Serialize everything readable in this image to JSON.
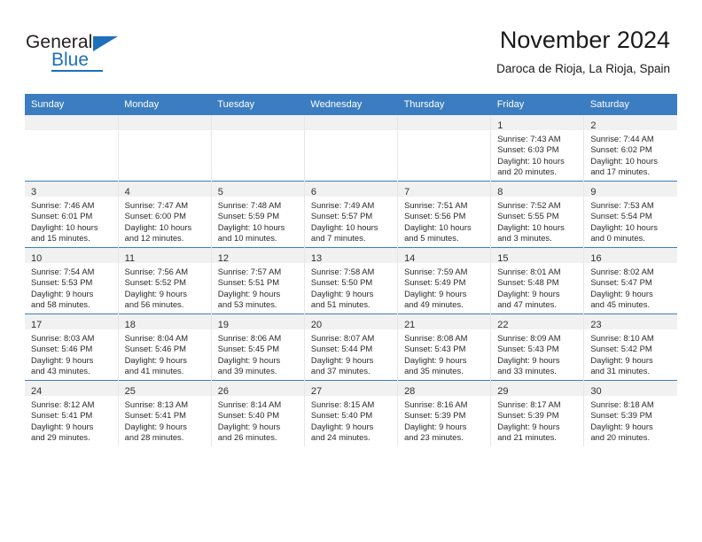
{
  "brand": {
    "name_top": "General",
    "name_bottom": "Blue",
    "accent_color": "#1f6fba"
  },
  "header": {
    "title": "November 2024",
    "subtitle": "Daroca de Rioja, La Rioja, Spain"
  },
  "theme": {
    "header_row_color": "#3b7dc0",
    "day_band_color": "#f1f1f1",
    "text_color": "#2a2a2a"
  },
  "weekdays": [
    "Sunday",
    "Monday",
    "Tuesday",
    "Wednesday",
    "Thursday",
    "Friday",
    "Saturday"
  ],
  "weeks": [
    [
      {
        "day": "",
        "empty": true
      },
      {
        "day": "",
        "empty": true
      },
      {
        "day": "",
        "empty": true
      },
      {
        "day": "",
        "empty": true
      },
      {
        "day": "",
        "empty": true
      },
      {
        "day": "1",
        "sunrise": "Sunrise: 7:43 AM",
        "sunset": "Sunset: 6:03 PM",
        "daylight1": "Daylight: 10 hours",
        "daylight2": "and 20 minutes."
      },
      {
        "day": "2",
        "sunrise": "Sunrise: 7:44 AM",
        "sunset": "Sunset: 6:02 PM",
        "daylight1": "Daylight: 10 hours",
        "daylight2": "and 17 minutes."
      }
    ],
    [
      {
        "day": "3",
        "sunrise": "Sunrise: 7:46 AM",
        "sunset": "Sunset: 6:01 PM",
        "daylight1": "Daylight: 10 hours",
        "daylight2": "and 15 minutes."
      },
      {
        "day": "4",
        "sunrise": "Sunrise: 7:47 AM",
        "sunset": "Sunset: 6:00 PM",
        "daylight1": "Daylight: 10 hours",
        "daylight2": "and 12 minutes."
      },
      {
        "day": "5",
        "sunrise": "Sunrise: 7:48 AM",
        "sunset": "Sunset: 5:59 PM",
        "daylight1": "Daylight: 10 hours",
        "daylight2": "and 10 minutes."
      },
      {
        "day": "6",
        "sunrise": "Sunrise: 7:49 AM",
        "sunset": "Sunset: 5:57 PM",
        "daylight1": "Daylight: 10 hours",
        "daylight2": "and 7 minutes."
      },
      {
        "day": "7",
        "sunrise": "Sunrise: 7:51 AM",
        "sunset": "Sunset: 5:56 PM",
        "daylight1": "Daylight: 10 hours",
        "daylight2": "and 5 minutes."
      },
      {
        "day": "8",
        "sunrise": "Sunrise: 7:52 AM",
        "sunset": "Sunset: 5:55 PM",
        "daylight1": "Daylight: 10 hours",
        "daylight2": "and 3 minutes."
      },
      {
        "day": "9",
        "sunrise": "Sunrise: 7:53 AM",
        "sunset": "Sunset: 5:54 PM",
        "daylight1": "Daylight: 10 hours",
        "daylight2": "and 0 minutes."
      }
    ],
    [
      {
        "day": "10",
        "sunrise": "Sunrise: 7:54 AM",
        "sunset": "Sunset: 5:53 PM",
        "daylight1": "Daylight: 9 hours",
        "daylight2": "and 58 minutes."
      },
      {
        "day": "11",
        "sunrise": "Sunrise: 7:56 AM",
        "sunset": "Sunset: 5:52 PM",
        "daylight1": "Daylight: 9 hours",
        "daylight2": "and 56 minutes."
      },
      {
        "day": "12",
        "sunrise": "Sunrise: 7:57 AM",
        "sunset": "Sunset: 5:51 PM",
        "daylight1": "Daylight: 9 hours",
        "daylight2": "and 53 minutes."
      },
      {
        "day": "13",
        "sunrise": "Sunrise: 7:58 AM",
        "sunset": "Sunset: 5:50 PM",
        "daylight1": "Daylight: 9 hours",
        "daylight2": "and 51 minutes."
      },
      {
        "day": "14",
        "sunrise": "Sunrise: 7:59 AM",
        "sunset": "Sunset: 5:49 PM",
        "daylight1": "Daylight: 9 hours",
        "daylight2": "and 49 minutes."
      },
      {
        "day": "15",
        "sunrise": "Sunrise: 8:01 AM",
        "sunset": "Sunset: 5:48 PM",
        "daylight1": "Daylight: 9 hours",
        "daylight2": "and 47 minutes."
      },
      {
        "day": "16",
        "sunrise": "Sunrise: 8:02 AM",
        "sunset": "Sunset: 5:47 PM",
        "daylight1": "Daylight: 9 hours",
        "daylight2": "and 45 minutes."
      }
    ],
    [
      {
        "day": "17",
        "sunrise": "Sunrise: 8:03 AM",
        "sunset": "Sunset: 5:46 PM",
        "daylight1": "Daylight: 9 hours",
        "daylight2": "and 43 minutes."
      },
      {
        "day": "18",
        "sunrise": "Sunrise: 8:04 AM",
        "sunset": "Sunset: 5:46 PM",
        "daylight1": "Daylight: 9 hours",
        "daylight2": "and 41 minutes."
      },
      {
        "day": "19",
        "sunrise": "Sunrise: 8:06 AM",
        "sunset": "Sunset: 5:45 PM",
        "daylight1": "Daylight: 9 hours",
        "daylight2": "and 39 minutes."
      },
      {
        "day": "20",
        "sunrise": "Sunrise: 8:07 AM",
        "sunset": "Sunset: 5:44 PM",
        "daylight1": "Daylight: 9 hours",
        "daylight2": "and 37 minutes."
      },
      {
        "day": "21",
        "sunrise": "Sunrise: 8:08 AM",
        "sunset": "Sunset: 5:43 PM",
        "daylight1": "Daylight: 9 hours",
        "daylight2": "and 35 minutes."
      },
      {
        "day": "22",
        "sunrise": "Sunrise: 8:09 AM",
        "sunset": "Sunset: 5:43 PM",
        "daylight1": "Daylight: 9 hours",
        "daylight2": "and 33 minutes."
      },
      {
        "day": "23",
        "sunrise": "Sunrise: 8:10 AM",
        "sunset": "Sunset: 5:42 PM",
        "daylight1": "Daylight: 9 hours",
        "daylight2": "and 31 minutes."
      }
    ],
    [
      {
        "day": "24",
        "sunrise": "Sunrise: 8:12 AM",
        "sunset": "Sunset: 5:41 PM",
        "daylight1": "Daylight: 9 hours",
        "daylight2": "and 29 minutes."
      },
      {
        "day": "25",
        "sunrise": "Sunrise: 8:13 AM",
        "sunset": "Sunset: 5:41 PM",
        "daylight1": "Daylight: 9 hours",
        "daylight2": "and 28 minutes."
      },
      {
        "day": "26",
        "sunrise": "Sunrise: 8:14 AM",
        "sunset": "Sunset: 5:40 PM",
        "daylight1": "Daylight: 9 hours",
        "daylight2": "and 26 minutes."
      },
      {
        "day": "27",
        "sunrise": "Sunrise: 8:15 AM",
        "sunset": "Sunset: 5:40 PM",
        "daylight1": "Daylight: 9 hours",
        "daylight2": "and 24 minutes."
      },
      {
        "day": "28",
        "sunrise": "Sunrise: 8:16 AM",
        "sunset": "Sunset: 5:39 PM",
        "daylight1": "Daylight: 9 hours",
        "daylight2": "and 23 minutes."
      },
      {
        "day": "29",
        "sunrise": "Sunrise: 8:17 AM",
        "sunset": "Sunset: 5:39 PM",
        "daylight1": "Daylight: 9 hours",
        "daylight2": "and 21 minutes."
      },
      {
        "day": "30",
        "sunrise": "Sunrise: 8:18 AM",
        "sunset": "Sunset: 5:39 PM",
        "daylight1": "Daylight: 9 hours",
        "daylight2": "and 20 minutes."
      }
    ]
  ]
}
